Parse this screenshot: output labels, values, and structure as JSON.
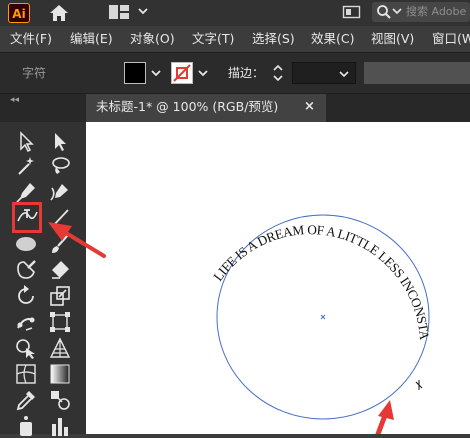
{
  "app": {
    "logo_text": "Ai",
    "search": {
      "placeholder": "搜索 Adobe"
    }
  },
  "menu": {
    "items": [
      {
        "label": "文件(F)"
      },
      {
        "label": "编辑(E)"
      },
      {
        "label": "对象(O)"
      },
      {
        "label": "文字(T)"
      },
      {
        "label": "选择(S)"
      },
      {
        "label": "效果(C)"
      },
      {
        "label": "视图(V)"
      },
      {
        "label": "窗口(W"
      }
    ]
  },
  "control_bar": {
    "type_label": "字符",
    "stroke_label": "描边：",
    "fill_color": "#000000",
    "stroke_color": "none"
  },
  "document": {
    "tab_title": "未标题-1* @ 100% (RGB/预览)",
    "close_glyph": "×"
  },
  "artboard": {
    "path_text": "LIFE IS A DREAM OF A LITTLE LESS INCONSTANT",
    "circle_stroke_color": "#4a6fc4",
    "annotation_color": "#e53935"
  },
  "tools": [
    {
      "name": "selection-tool-icon"
    },
    {
      "name": "direct-selection-tool-icon"
    },
    {
      "name": "magic-wand-tool-icon"
    },
    {
      "name": "lasso-tool-icon"
    },
    {
      "name": "pen-tool-icon"
    },
    {
      "name": "curvature-tool-icon"
    },
    {
      "name": "type-on-path-tool-icon"
    },
    {
      "name": "line-segment-tool-icon"
    },
    {
      "name": "ellipse-tool-icon"
    },
    {
      "name": "paintbrush-tool-icon"
    },
    {
      "name": "shaper-tool-icon"
    },
    {
      "name": "eraser-tool-icon"
    },
    {
      "name": "rotate-tool-icon"
    },
    {
      "name": "scale-tool-icon"
    },
    {
      "name": "puppet-warp-tool-icon"
    },
    {
      "name": "free-transform-tool-icon"
    },
    {
      "name": "shape-builder-tool-icon"
    },
    {
      "name": "perspective-grid-tool-icon"
    },
    {
      "name": "mesh-tool-icon"
    },
    {
      "name": "gradient-tool-icon"
    },
    {
      "name": "eyedropper-tool-icon"
    },
    {
      "name": "blend-tool-icon"
    },
    {
      "name": "symbol-sprayer-tool-icon"
    },
    {
      "name": "column-graph-tool-icon"
    }
  ]
}
